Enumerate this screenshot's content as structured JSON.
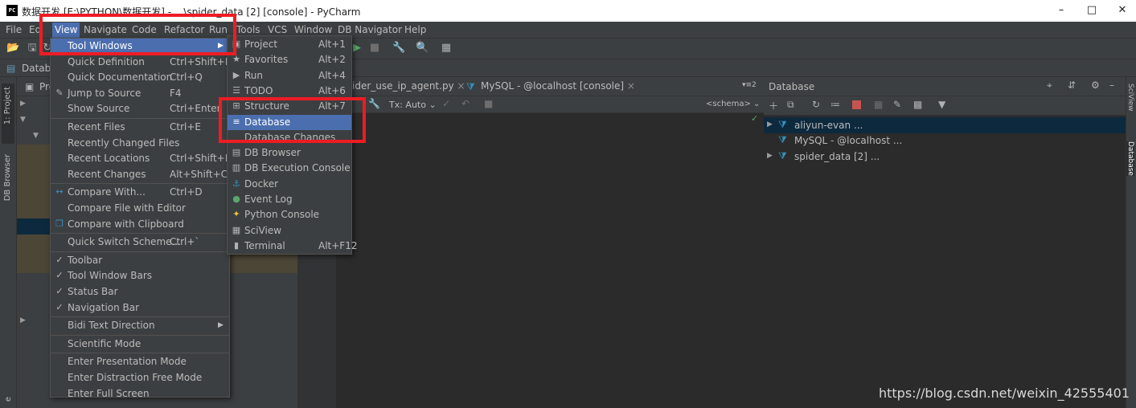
{
  "window": {
    "title": "数据开发 [E:\\PYTHON\\数据开发] - ...\\spider_data [2] [console] - PyCharm",
    "app_badge": "PC"
  },
  "menubar": [
    "File",
    "Ed",
    "View",
    "Navigate",
    "Code",
    "Refactor",
    "Run",
    "Tools",
    "VCS",
    "Window",
    "DB Navigator",
    "Help"
  ],
  "navbar": {
    "crumb": "Databa"
  },
  "left_strip": {
    "project": "1: Project",
    "db_browser": "DB Browser",
    "bottom": "e"
  },
  "project_panel": {
    "title": "Pro"
  },
  "editor_tabs": [
    {
      "label": "ider_use_ip_agent.py",
      "close": "×"
    },
    {
      "label": "MySQL - @localhost [console]",
      "close": "×"
    }
  ],
  "editor_tabs_more": "▾≡2",
  "editor_toolbar": {
    "tx": "Tx: Auto",
    "schema": "<schema>"
  },
  "db_panel": {
    "title": "Database",
    "items": [
      {
        "label": "aliyun-evan ...",
        "expanded": false,
        "selected": true
      },
      {
        "label": "MySQL - @localhost ...",
        "expanded": false,
        "selected": false
      },
      {
        "label": "spider_data [2] ...",
        "expanded": false,
        "selected": false
      }
    ]
  },
  "right_strip": {
    "sciview": "SciView",
    "database": "Database"
  },
  "view_menu": [
    {
      "label": "Tool Windows",
      "shortcut": "",
      "submenu": true,
      "highlighted": true,
      "icon": ""
    },
    {
      "label": "Quick Definition",
      "shortcut": "Ctrl+Shift+I",
      "icon": ""
    },
    {
      "label": "Quick Documentation",
      "shortcut": "Ctrl+Q",
      "icon": ""
    },
    {
      "label": "Jump to Source",
      "shortcut": "F4",
      "icon": "pencil-icon"
    },
    {
      "label": "Show Source",
      "shortcut": "Ctrl+Enter",
      "icon": ""
    },
    {
      "sep": true
    },
    {
      "label": "Recent Files",
      "shortcut": "Ctrl+E",
      "icon": ""
    },
    {
      "label": "Recently Changed Files",
      "shortcut": "",
      "icon": ""
    },
    {
      "label": "Recent Locations",
      "shortcut": "Ctrl+Shift+E",
      "icon": ""
    },
    {
      "label": "Recent Changes",
      "shortcut": "Alt+Shift+C",
      "icon": ""
    },
    {
      "sep": true
    },
    {
      "label": "Compare With...",
      "shortcut": "Ctrl+D",
      "icon": "compare-icon"
    },
    {
      "label": "Compare File with Editor",
      "shortcut": "",
      "icon": ""
    },
    {
      "label": "Compare with Clipboard",
      "shortcut": "",
      "icon": "compare-clipboard-icon"
    },
    {
      "sep": true
    },
    {
      "label": "Quick Switch Scheme...",
      "shortcut": "Ctrl+`",
      "icon": ""
    },
    {
      "sep": true
    },
    {
      "label": "Toolbar",
      "shortcut": "",
      "icon": "check-icon"
    },
    {
      "label": "Tool Window Bars",
      "shortcut": "",
      "icon": "check-icon"
    },
    {
      "label": "Status Bar",
      "shortcut": "",
      "icon": "check-icon"
    },
    {
      "label": "Navigation Bar",
      "shortcut": "",
      "icon": "check-icon"
    },
    {
      "sep": true
    },
    {
      "label": "Bidi Text Direction",
      "shortcut": "",
      "submenu": true,
      "icon": ""
    },
    {
      "sep": true
    },
    {
      "label": "Scientific Mode",
      "shortcut": "",
      "icon": ""
    },
    {
      "sep": true
    },
    {
      "label": "Enter Presentation Mode",
      "shortcut": "",
      "icon": ""
    },
    {
      "label": "Enter Distraction Free Mode",
      "shortcut": "",
      "icon": ""
    },
    {
      "label": "Enter Full Screen",
      "shortcut": "",
      "icon": ""
    }
  ],
  "tool_windows_menu": [
    {
      "label": "Project",
      "shortcut": "Alt+1",
      "icon": "folder-icon"
    },
    {
      "label": "Favorites",
      "shortcut": "Alt+2",
      "icon": "star-icon"
    },
    {
      "label": "Run",
      "shortcut": "Alt+4",
      "icon": "run-icon"
    },
    {
      "label": "TODO",
      "shortcut": "Alt+6",
      "icon": "todo-icon"
    },
    {
      "label": "Structure",
      "shortcut": "Alt+7",
      "icon": "structure-icon"
    },
    {
      "label": "Database",
      "shortcut": "",
      "icon": "database-icon",
      "highlighted": true
    },
    {
      "label": "Database Changes",
      "shortcut": "",
      "icon": ""
    },
    {
      "label": "DB Browser",
      "shortcut": "",
      "icon": "db-browser-icon"
    },
    {
      "label": "DB Execution Console",
      "shortcut": "",
      "icon": "db-console-icon"
    },
    {
      "label": "Docker",
      "shortcut": "",
      "icon": "docker-icon"
    },
    {
      "label": "Event Log",
      "shortcut": "",
      "icon": "event-log-icon"
    },
    {
      "label": "Python Console",
      "shortcut": "",
      "icon": "python-icon"
    },
    {
      "label": "SciView",
      "shortcut": "",
      "icon": "sciview-icon"
    },
    {
      "label": "Terminal",
      "shortcut": "Alt+F12",
      "icon": "terminal-icon"
    }
  ],
  "watermark": "https://blog.csdn.net/weixin_42555401",
  "colors": {
    "highlight": "#4b6eaf",
    "annotation_red": "#ee1c24",
    "panel": "#3c3f41",
    "editor": "#2b2b2b"
  }
}
